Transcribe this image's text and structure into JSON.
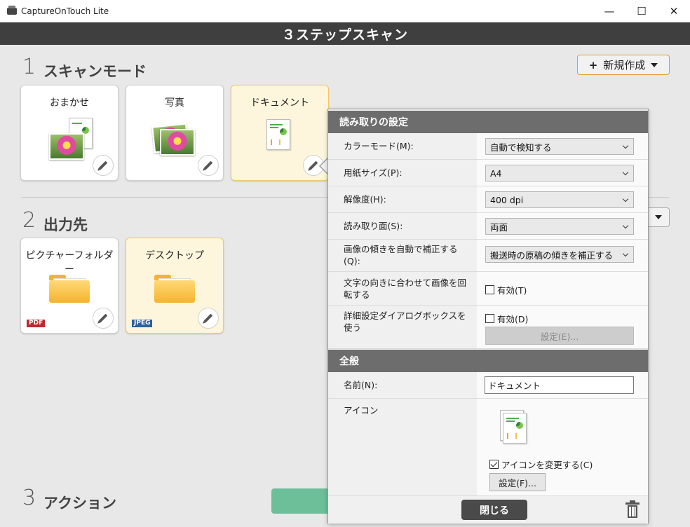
{
  "window": {
    "title": "CaptureOnTouch Lite",
    "minimize": "—",
    "maximize": "☐",
    "close": "✕"
  },
  "header": {
    "title": "３ステップスキャン"
  },
  "sections": {
    "scan_mode": {
      "number": "1",
      "title": "スキャンモード"
    },
    "output": {
      "number": "2",
      "title": "出力先"
    },
    "action": {
      "number": "3",
      "title": "アクション"
    }
  },
  "new_button": {
    "plus": "+",
    "label": "新規作成"
  },
  "scan_cards": [
    {
      "label": "おまかせ",
      "icon": "auto-scan-icon"
    },
    {
      "label": "写真",
      "icon": "photo-icon"
    },
    {
      "label": "ドキュメント",
      "icon": "document-icon",
      "selected": true
    }
  ],
  "output_cards": [
    {
      "label": "ピクチャーフォルダー",
      "badge": "PDF",
      "icon": "folder-icon"
    },
    {
      "label": "デスクトップ",
      "badge": "JPEG",
      "icon": "folder-icon",
      "selected": true
    }
  ],
  "settings": {
    "read_header": "読み取りの設定",
    "color_mode": {
      "label": "カラーモード(M):",
      "value": "自動で検知する"
    },
    "paper_size": {
      "label": "用紙サイズ(P):",
      "value": "A4"
    },
    "resolution": {
      "label": "解像度(H):",
      "value": "400 dpi"
    },
    "scan_side": {
      "label": "読み取り面(S):",
      "value": "両面"
    },
    "deskew": {
      "label": "画像の傾きを自動で補正する(Q):",
      "value": "搬送時の原稿の傾きを補正する"
    },
    "rotate": {
      "label": "文字の向きに合わせて画像を回転する",
      "check_label": "有効(T)",
      "checked": false
    },
    "advanced": {
      "label": "詳細設定ダイアログボックスを使う",
      "check_label": "有効(D)",
      "checked": false,
      "settings_button": "設定(E)..."
    },
    "general_header": "全般",
    "name": {
      "label": "名前(N):",
      "value": "ドキュメント"
    },
    "icon": {
      "label": "アイコン",
      "change_label": "アイコンを変更する(C)",
      "checked": true,
      "settings_button": "設定(F)..."
    },
    "close_button": "閉じる"
  }
}
